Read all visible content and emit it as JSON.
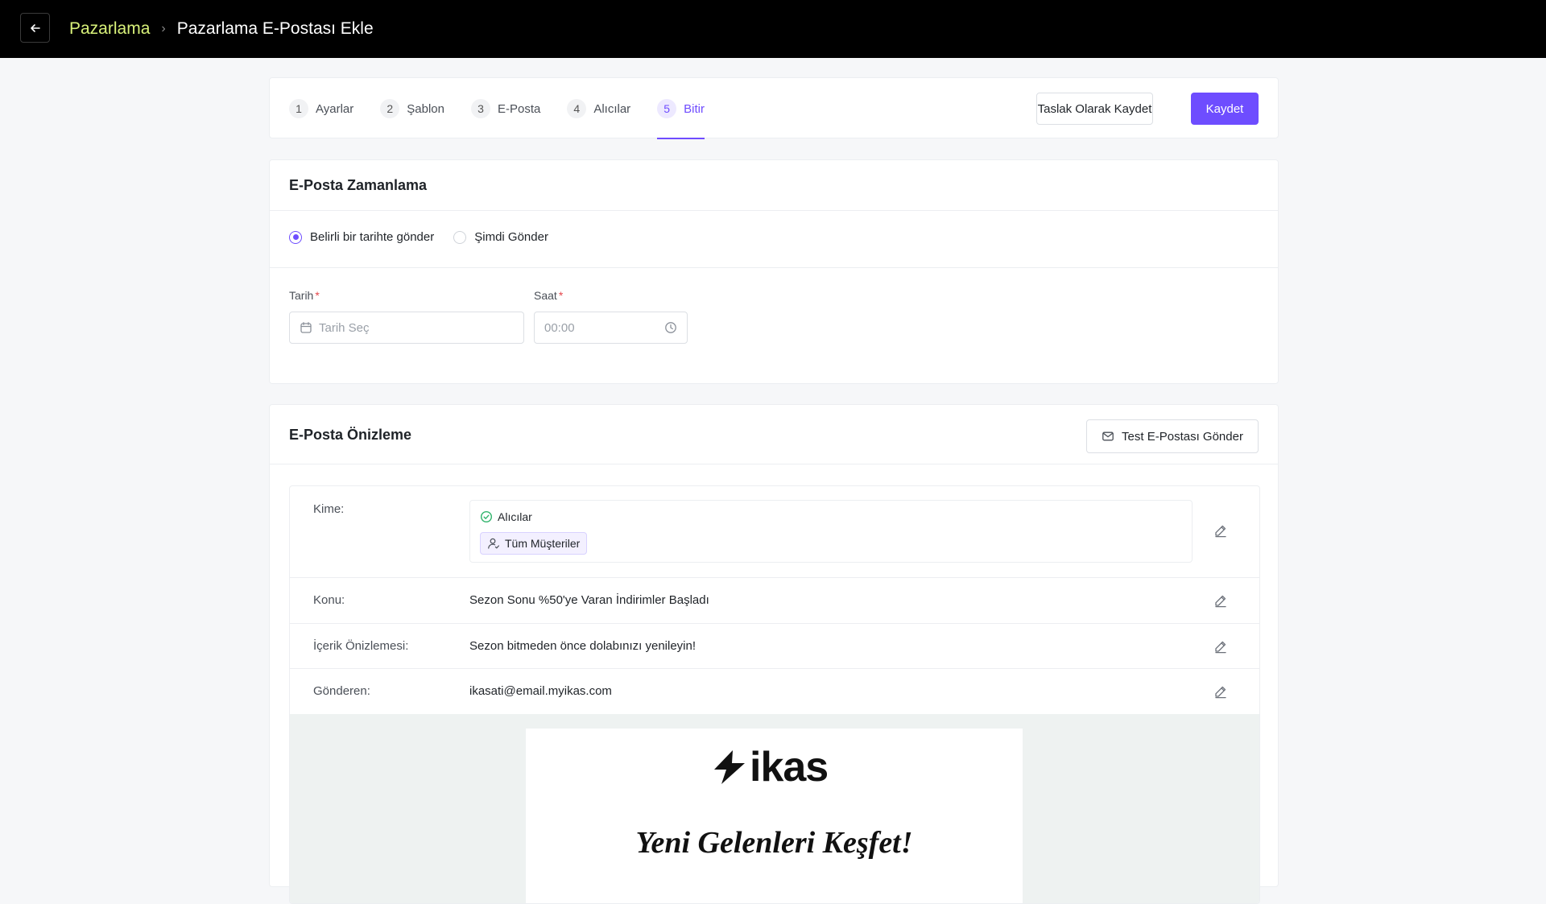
{
  "header": {
    "breadcrumb_root": "Pazarlama",
    "breadcrumb_current": "Pazarlama E-Postası Ekle"
  },
  "stepper": {
    "steps": [
      {
        "num": "1",
        "label": "Ayarlar"
      },
      {
        "num": "2",
        "label": "Şablon"
      },
      {
        "num": "3",
        "label": "E-Posta"
      },
      {
        "num": "4",
        "label": "Alıcılar"
      },
      {
        "num": "5",
        "label": "Bitir"
      }
    ],
    "active_step": 5,
    "draft_label": "Taslak Olarak Kaydet",
    "save_label": "Kaydet"
  },
  "schedule": {
    "title": "E-Posta Zamanlama",
    "option_scheduled": "Belirli bir tarihte gönder",
    "option_now": "Şimdi Gönder",
    "selected_option": "scheduled",
    "date_label": "Tarih",
    "date_placeholder": "Tarih Seç",
    "time_label": "Saat",
    "time_placeholder": "00:00",
    "required_mark": "*"
  },
  "preview": {
    "title": "E-Posta Önizleme",
    "test_button": "Test E-Postası Gönder",
    "to_label": "Kime:",
    "recipients_title": "Alıcılar",
    "recipients_chip": "Tüm Müşteriler",
    "subject_label": "Konu:",
    "subject_value": "Sezon Sonu %50'ye Varan İndirimler Başladı",
    "preheader_label": "İçerik Önizlemesi:",
    "preheader_value": "Sezon bitmeden önce dolabınızı yenileyin!",
    "sender_label": "Gönderen:",
    "sender_value": "ikasati@email.myikas.com",
    "email": {
      "logo_text": "ikas",
      "headline": "Yeni Gelenleri Keşfet!"
    }
  },
  "colors": {
    "accent": "#6e4dff",
    "breadcrumb_root": "#d9f27a",
    "success": "#2fb36b"
  }
}
